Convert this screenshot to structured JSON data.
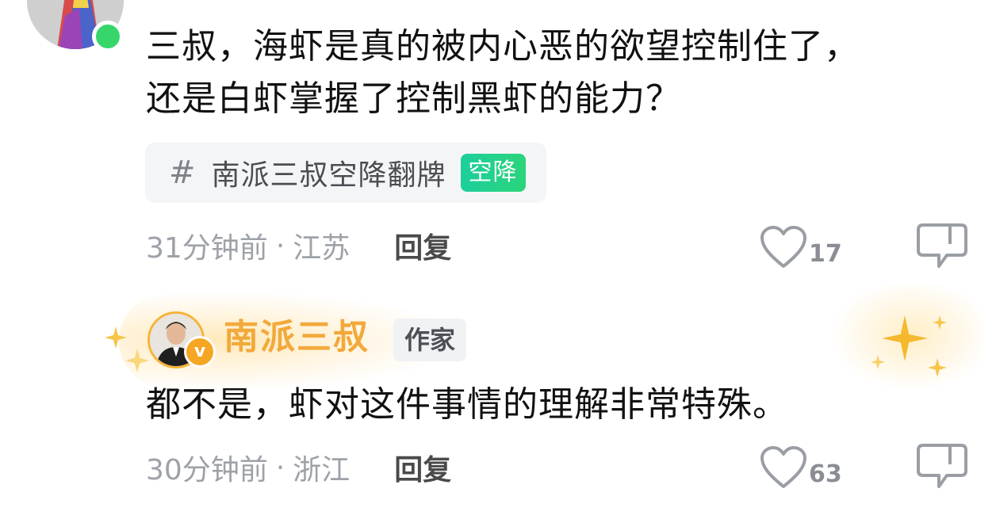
{
  "comments": [
    {
      "text_line1": "三叔，海虾是真的被内心恶的欲望控制住了，",
      "text_line2": "还是白虾掌握了控制黑虾的能力？",
      "topic": {
        "hash": "#",
        "label": "南派三叔空降翻牌",
        "badge": "空降"
      },
      "time": "31分钟前",
      "separator": "·",
      "location": "江苏",
      "reply_label": "回复",
      "likes": "17"
    },
    {
      "author_name": "南派三叔",
      "author_tag": "作家",
      "verified_badge": "v",
      "text": "都不是，虾对这件事情的理解非常特殊。",
      "time": "30分钟前",
      "separator": "·",
      "location": "浙江",
      "reply_label": "回复",
      "likes": "63"
    }
  ],
  "icons": {
    "like": "heart-outline-icon",
    "comment": "speech-bubble-icon",
    "online": "online-status-dot",
    "sparkle": "sparkle-icon"
  },
  "colors": {
    "author_name": "#f2a93b",
    "badge_green": "#1ccf9c",
    "meta_gray": "#9ea2a8",
    "online_green": "#36d66b"
  }
}
